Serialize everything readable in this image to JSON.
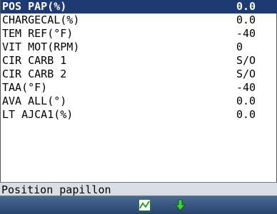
{
  "rows": [
    {
      "label": "POS PAP(%)",
      "value": "0.0",
      "selected": true
    },
    {
      "label": "CHARGECAL(%)",
      "value": "0.0",
      "selected": false
    },
    {
      "label": "TEM REF(°F)",
      "value": "-40",
      "selected": false
    },
    {
      "label": "VIT MOT(RPM)",
      "value": "0",
      "selected": false
    },
    {
      "label": "CIR CARB 1",
      "value": "S/O",
      "selected": false
    },
    {
      "label": "CIR CARB 2",
      "value": "S/O",
      "selected": false
    },
    {
      "label": "TAA(°F)",
      "value": "-40",
      "selected": false
    },
    {
      "label": "AVA ALL(°)",
      "value": "0.0",
      "selected": false
    },
    {
      "label": "LT AJCA1(%)",
      "value": "0.0",
      "selected": false
    }
  ],
  "status": {
    "text": "Position papillon"
  },
  "toolbar": {
    "icons": [
      "graph-icon",
      "scroll-down-arrow-icon"
    ]
  },
  "colors": {
    "selected_row": "#1e3a73",
    "toolbar": "#27446e",
    "status_bar": "#d9dde6"
  }
}
